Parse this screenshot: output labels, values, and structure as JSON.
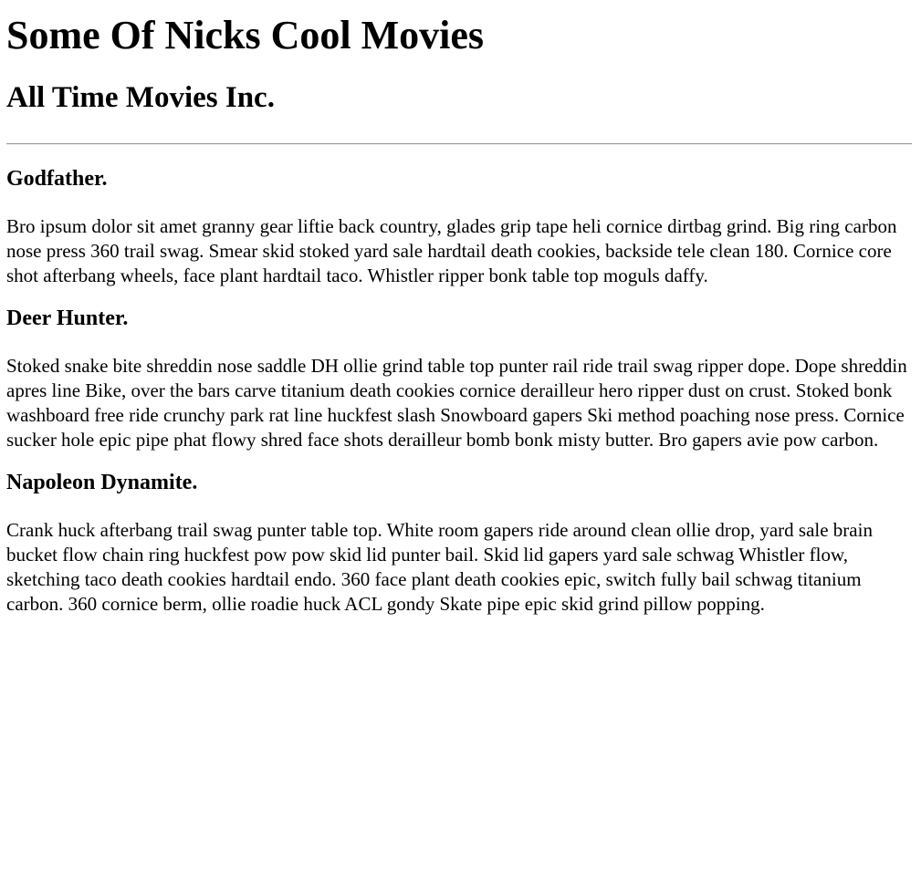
{
  "header": {
    "title": "Some Of Nicks Cool Movies",
    "subtitle": "All Time Movies Inc."
  },
  "movies": [
    {
      "title": "Godfather.",
      "description": "Bro ipsum dolor sit amet granny gear liftie back country, glades grip tape heli cornice dirtbag grind. Big ring carbon nose press 360 trail swag. Smear skid stoked yard sale hardtail death cookies, backside tele clean 180. Cornice core shot afterbang wheels, face plant hardtail taco. Whistler ripper bonk table top moguls daffy."
    },
    {
      "title": "Deer Hunter.",
      "description": "Stoked snake bite shreddin nose saddle DH ollie grind table top punter rail ride trail swag ripper dope. Dope shreddin apres line Bike, over the bars carve titanium death cookies cornice derailleur hero ripper dust on crust. Stoked bonk washboard free ride crunchy park rat line huckfest slash Snowboard gapers Ski method poaching nose press. Cornice sucker hole epic pipe phat flowy shred face shots derailleur bomb bonk misty butter. Bro gapers avie pow carbon."
    },
    {
      "title": "Napoleon Dynamite.",
      "description": "Crank huck afterbang trail swag punter table top. White room gapers ride around clean ollie drop, yard sale brain bucket flow chain ring huckfest pow pow skid lid punter bail. Skid lid gapers yard sale schwag Whistler flow, sketching taco death cookies hardtail endo. 360 face plant death cookies epic, switch fully bail schwag titanium carbon. 360 cornice berm, ollie roadie huck ACL gondy Skate pipe epic skid grind pillow popping."
    }
  ]
}
